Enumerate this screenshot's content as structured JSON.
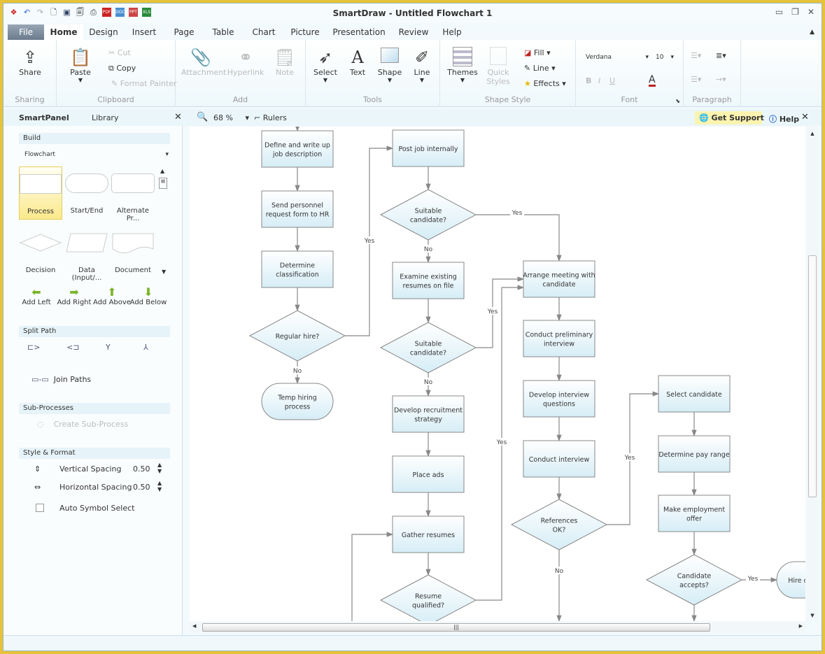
{
  "app": {
    "title": "SmartDraw - Untitled Flowchart 1"
  },
  "quick_access": [
    "app-logo-icon",
    "undo-icon",
    "redo-icon",
    "new-icon",
    "save-icon",
    "print-preview-icon",
    "print-icon",
    "export-pdf-icon",
    "export-doc-icon",
    "export-ppt-icon",
    "export-xls-icon"
  ],
  "tabs": [
    "File",
    "Home",
    "Design",
    "Insert",
    "Page",
    "Table",
    "Chart",
    "Picture",
    "Presentation",
    "Review",
    "Help"
  ],
  "ribbon": {
    "sharing": {
      "label": "Sharing",
      "share": "Share"
    },
    "clipboard": {
      "label": "Clipboard",
      "paste": "Paste",
      "cut": "Cut",
      "copy": "Copy",
      "format_painter": "Format Painter"
    },
    "add": {
      "label": "Add",
      "attachment": "Attachment",
      "hyperlink": "Hyperlink",
      "note": "Note"
    },
    "tools": {
      "label": "Tools",
      "select": "Select",
      "text": "Text",
      "shape": "Shape",
      "line": "Line"
    },
    "shape_style": {
      "label": "Shape Style",
      "themes": "Themes",
      "quick_styles": "Quick Styles",
      "fill": "Fill",
      "line": "Line",
      "effects": "Effects"
    },
    "font": {
      "label": "Font",
      "family": "Verdana",
      "size": "10"
    },
    "paragraph": {
      "label": "Paragraph"
    }
  },
  "panel_bar": {
    "smartpanel": "SmartPanel",
    "library": "Library",
    "zoom": "68 %",
    "rulers": "Rulers",
    "get_support": "Get Support",
    "help": "Help"
  },
  "smartpanel": {
    "build": "Build",
    "library_select": "Flowchart",
    "shapes": [
      "Process",
      "Start/End",
      "Alternate Pr...",
      "Decision",
      "Data (Input/...",
      "Document"
    ],
    "add_buttons": [
      "Add Left",
      "Add Right",
      "Add Above",
      "Add Below"
    ],
    "split_path": "Split Path",
    "join_paths": "Join Paths",
    "sub_processes": "Sub-Processes",
    "create_sub_process": "Create Sub-Process",
    "style_format": "Style & Format",
    "vertical_spacing": {
      "label": "Vertical Spacing",
      "value": "0.50"
    },
    "horizontal_spacing": {
      "label": "Horizontal Spacing",
      "value": "0.50"
    },
    "auto_symbol_select": {
      "label": "Auto Symbol Select",
      "checked": false
    }
  },
  "flowchart": {
    "nodes": [
      "Define and write up|job description",
      "Send personnel|request form to HR",
      "Determine|classification",
      "Regular hire?",
      "Temp hiring|process",
      "Post job internally",
      "Suitable|candidate?",
      "Examine existing|resumes on file",
      "Suitable|candidate?",
      "Develop recruitment|strategy",
      "Place ads",
      "Gather resumes",
      "Resume|qualified?",
      "Arrange meeting with|candidate",
      "Conduct preliminary|interview",
      "Develop interview|questions",
      "Conduct interview",
      "References|OK?",
      "Select candidate",
      "Determine pay range",
      "Make employment|offer",
      "Candidate|accepts?",
      "Hire candidate"
    ],
    "edge_labels": [
      "No",
      "Yes",
      "Yes",
      "No",
      "Yes",
      "No",
      "Yes",
      "No",
      "Yes",
      "Yes"
    ]
  },
  "colors": {
    "accent_border": "#e8c23a",
    "node_fill_top": "#ffffff",
    "node_fill_bottom": "#d8eef6",
    "selected_shape": "#fbe98a"
  }
}
